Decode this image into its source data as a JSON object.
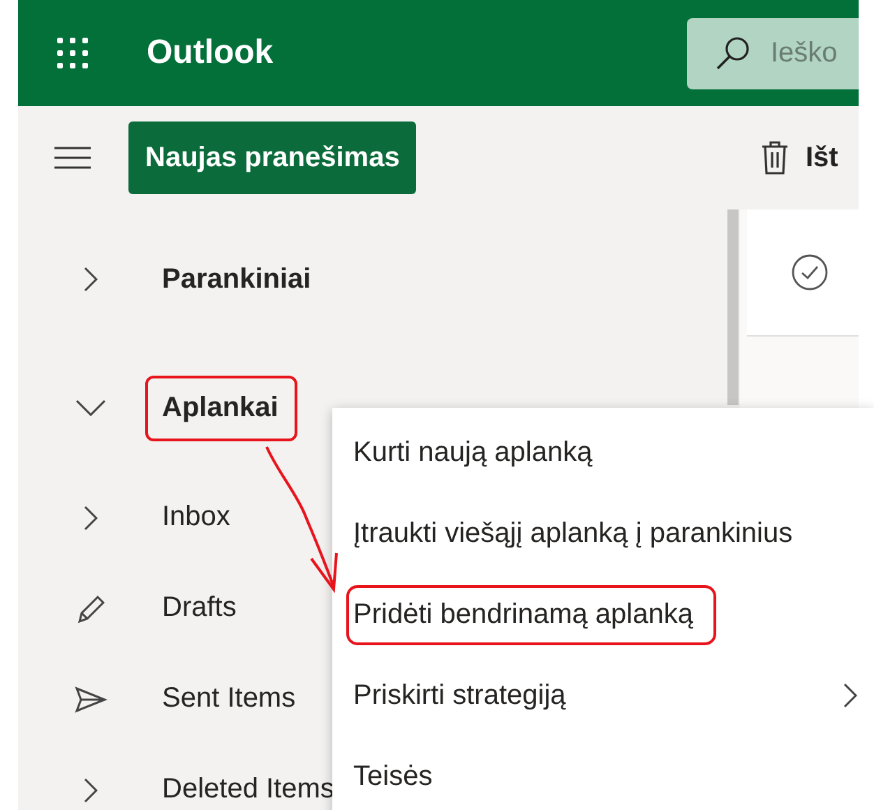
{
  "header": {
    "app_title": "Outlook",
    "search": {
      "placeholder": "Ieško"
    }
  },
  "toolbar": {
    "new_button": "Naujas pranešimas",
    "delete_button": "Išt"
  },
  "nav": [
    {
      "kind": "section",
      "label": "Parankiniai",
      "expanded": false,
      "highlighted": false
    },
    {
      "kind": "section",
      "label": "Aplankai",
      "expanded": true,
      "highlighted": true
    },
    {
      "kind": "folder",
      "expanded": false,
      "label": "Inbox"
    },
    {
      "kind": "drafts",
      "label": "Drafts"
    },
    {
      "kind": "sent",
      "label": "Sent Items"
    },
    {
      "kind": "folder",
      "expanded": false,
      "label": "Deleted Items"
    }
  ],
  "context_menu": {
    "items": [
      {
        "label": "Kurti naują aplanką",
        "has_submenu": false,
        "highlighted": false
      },
      {
        "label": "Įtraukti viešąjį aplanką į parankinius",
        "has_submenu": false,
        "highlighted": false
      },
      {
        "label": "Pridėti bendrinamą aplanką",
        "has_submenu": false,
        "highlighted": true
      },
      {
        "label": "Priskirti strategiją",
        "has_submenu": true,
        "highlighted": false
      },
      {
        "label": "Teisės",
        "has_submenu": false,
        "highlighted": false
      }
    ]
  },
  "annotation": {
    "arrow": true
  }
}
